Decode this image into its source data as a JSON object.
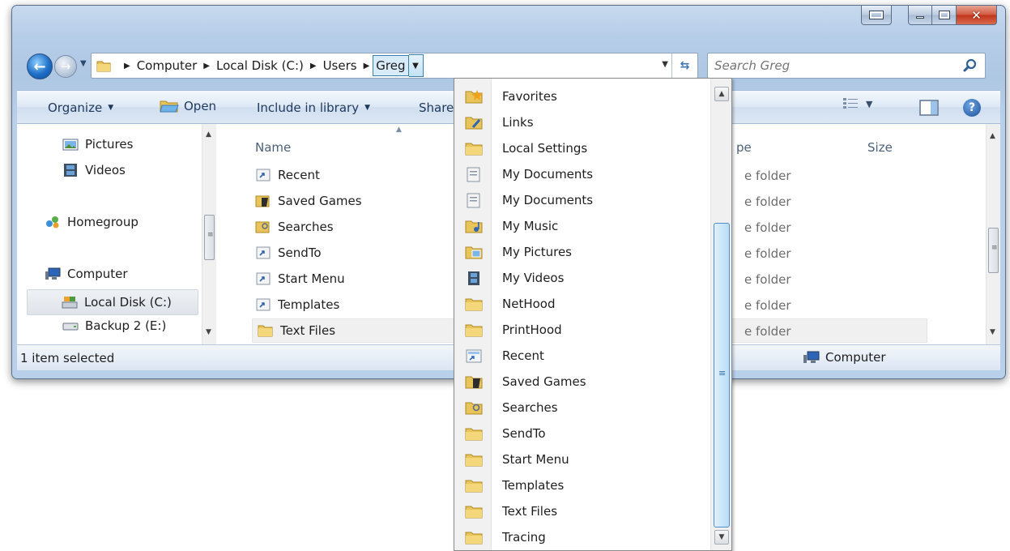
{
  "window": {
    "colors": {
      "frame": "#b6cde8",
      "close": "#c0341a",
      "accent": "#3c7fb1"
    }
  },
  "address": {
    "crumbs": [
      "Computer",
      "Local Disk (C:)",
      "Users",
      "Greg"
    ]
  },
  "search": {
    "placeholder": "Search Greg"
  },
  "toolbar": {
    "organize": "Organize",
    "open": "Open",
    "include": "Include in library",
    "share": "Share"
  },
  "nav_pane": {
    "items": [
      {
        "label": "Pictures",
        "icon": "pictures-icon"
      },
      {
        "label": "Videos",
        "icon": "videos-icon"
      },
      {
        "label": "Homegroup",
        "icon": "homegroup-icon"
      },
      {
        "label": "Computer",
        "icon": "computer-icon"
      },
      {
        "label": "Local Disk (C:)",
        "icon": "local-disk-icon",
        "selected": true
      },
      {
        "label": "Backup 2 (E:)",
        "icon": "drive-icon"
      }
    ]
  },
  "files": {
    "columns": {
      "name": "Name",
      "type_partial": "pe",
      "size": "Size"
    },
    "rows": [
      {
        "name": "Recent",
        "type": "e folder",
        "icon": "shortcut-folder-icon"
      },
      {
        "name": "Saved Games",
        "type": "e folder",
        "icon": "saved-games-icon"
      },
      {
        "name": "Searches",
        "type": "e folder",
        "icon": "searches-icon"
      },
      {
        "name": "SendTo",
        "type": "e folder",
        "icon": "shortcut-folder-icon"
      },
      {
        "name": "Start Menu",
        "type": "e folder",
        "icon": "shortcut-folder-icon"
      },
      {
        "name": "Templates",
        "type": "e folder",
        "icon": "shortcut-folder-icon"
      },
      {
        "name": "Text Files",
        "type": "e folder",
        "icon": "folder-icon",
        "selected": true
      }
    ]
  },
  "status": {
    "text": "1 item selected",
    "location": "Computer"
  },
  "dropdown": {
    "items": [
      "Favorites",
      "Links",
      "Local Settings",
      "My Documents",
      "My Documents",
      "My Music",
      "My Pictures",
      "My Videos",
      "NetHood",
      "PrintHood",
      "Recent",
      "Saved Games",
      "Searches",
      "SendTo",
      "Start Menu",
      "Templates",
      "Text Files",
      "Tracing"
    ],
    "icons": [
      "favorites-folder-icon",
      "links-folder-icon",
      "folder-icon",
      "documents-folder-icon",
      "documents-folder-icon",
      "music-folder-icon",
      "pictures-folder-icon",
      "videos-folder-icon",
      "folder-icon",
      "folder-icon",
      "recent-icon",
      "saved-games-icon",
      "searches-icon",
      "folder-icon",
      "folder-icon",
      "folder-icon",
      "folder-icon",
      "folder-icon"
    ]
  }
}
